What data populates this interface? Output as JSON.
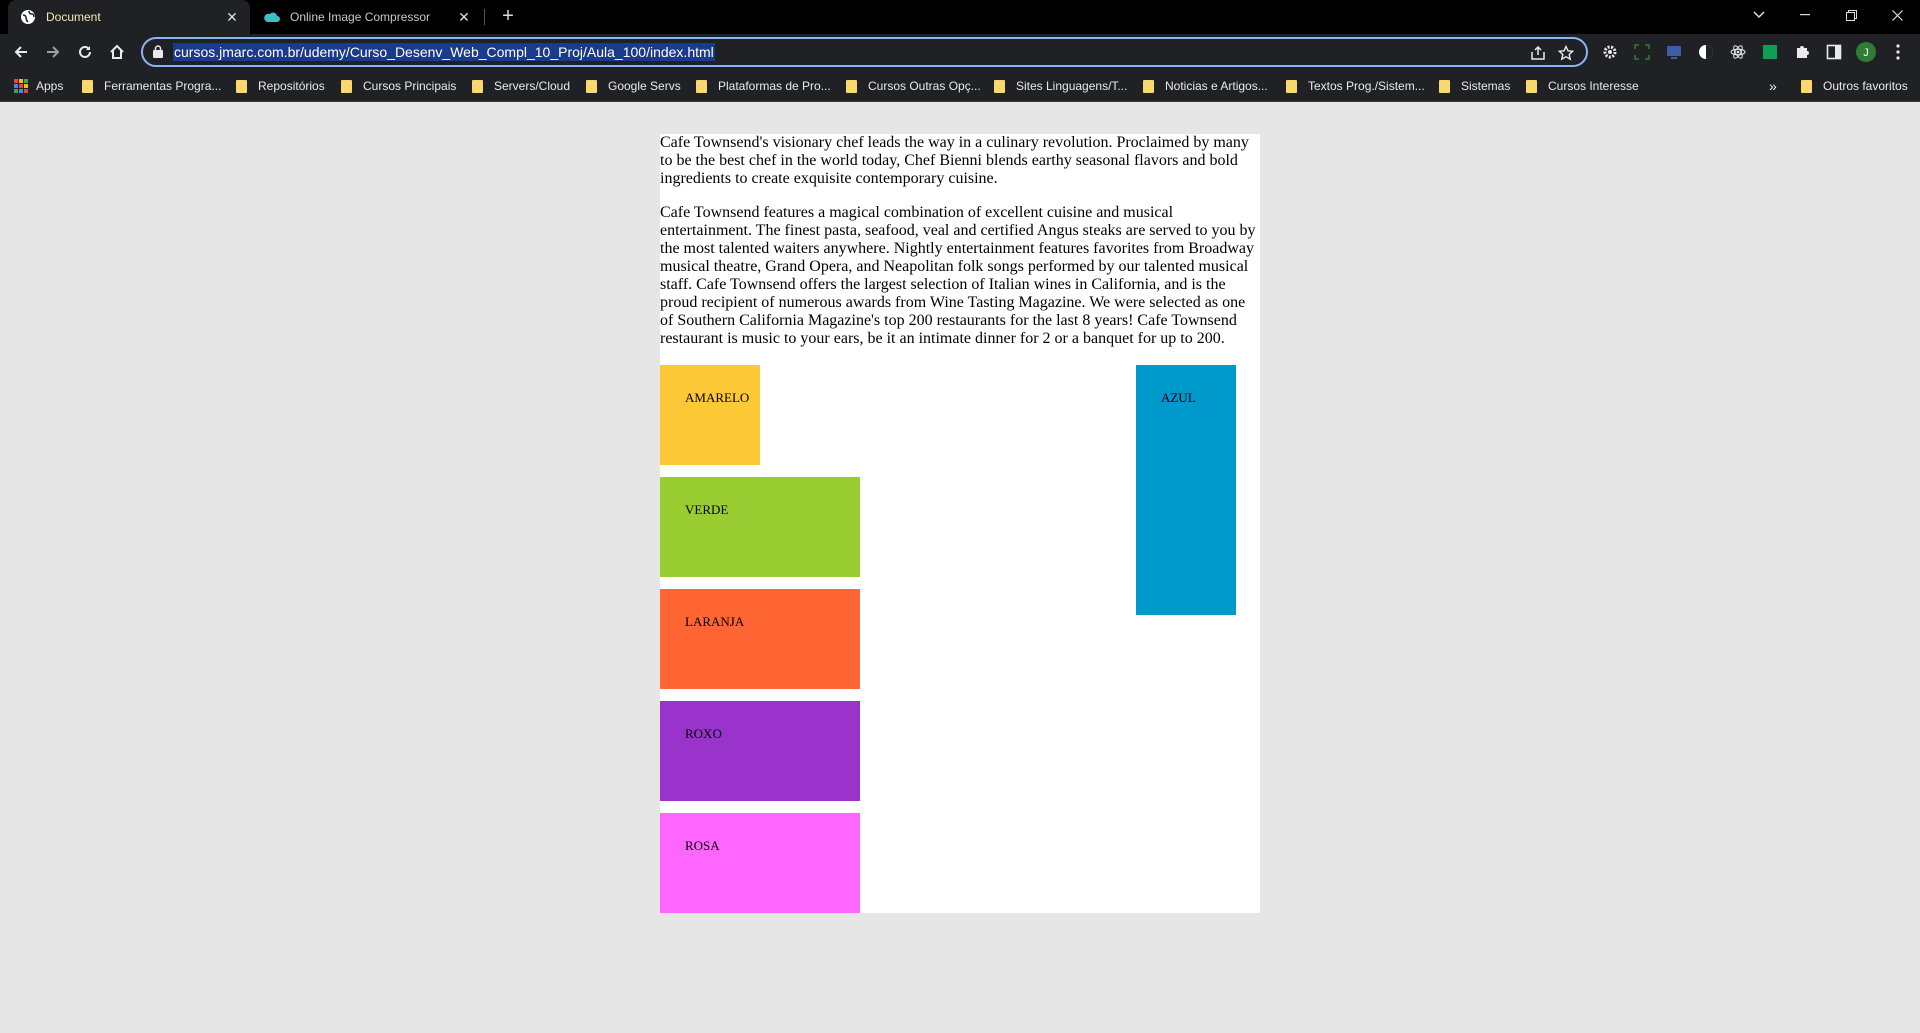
{
  "browser": {
    "tabs": [
      {
        "title": "Document",
        "active": true
      },
      {
        "title": "Online Image Compressor",
        "active": false
      }
    ],
    "url": "cursos.jmarc.com.br/udemy/Curso_Desenv_Web_Compl_10_Proj/Aula_100/index.html",
    "profile_initial": "J",
    "bookmarks": [
      "Apps",
      "Ferramentas Progra...",
      "Repositórios",
      "Cursos Principais",
      "Servers/Cloud",
      "Google Servs",
      "Plataformas de Pro...",
      "Cursos Outras Opç...",
      "Sites Linguagens/T...",
      "Noticias e Artigos...",
      "Textos Prog./Sistem...",
      "Sistemas",
      "Cursos Interesse"
    ],
    "overflow_label": "»",
    "other_bookmarks": "Outros favoritos"
  },
  "page": {
    "paragraphs": [
      "Cafe Townsend's visionary chef leads the way in a culinary revolution. Proclaimed by many to be the best chef in the world today, Chef Bienni blends earthy seasonal flavors and bold ingredients to create exquisite contemporary cuisine.",
      "Cafe Townsend features a magical combination of excellent cuisine and musical entertainment. The finest pasta, seafood, veal and certified Angus steaks are served to you by the most talented waiters anywhere. Nightly entertainment features favorites from Broadway musical theatre, Grand Opera, and Neapolitan folk songs performed by our talented musical staff. Cafe Townsend offers the largest selection of Italian wines in California, and is the proud recipient of numerous awards from Wine Tasting Magazine. We were selected as one of Southern California Magazine's top 200 restaurants for the last 8 years! Cafe Townsend restaurant is music to your ears, be it an intimate dinner for 2 or a banquet for up to 200."
    ],
    "boxes": {
      "amarelo": {
        "label": "AMARELO",
        "color": "#fec937"
      },
      "verde": {
        "label": "VERDE",
        "color": "#9acd32"
      },
      "laranja": {
        "label": "LARANJA",
        "color": "#ff6633"
      },
      "roxo": {
        "label": "ROXO",
        "color": "#9933cc"
      },
      "rosa": {
        "label": "ROSA",
        "color": "#ff66ff"
      },
      "azul": {
        "label": "AZUL",
        "color": "#0099cc"
      }
    }
  },
  "colors": {
    "accent": "#8ab4f8",
    "tab_active_text": "#f8e7b0",
    "bookmark_folder": "#f9d771",
    "page_background": "#e6e6e6"
  }
}
